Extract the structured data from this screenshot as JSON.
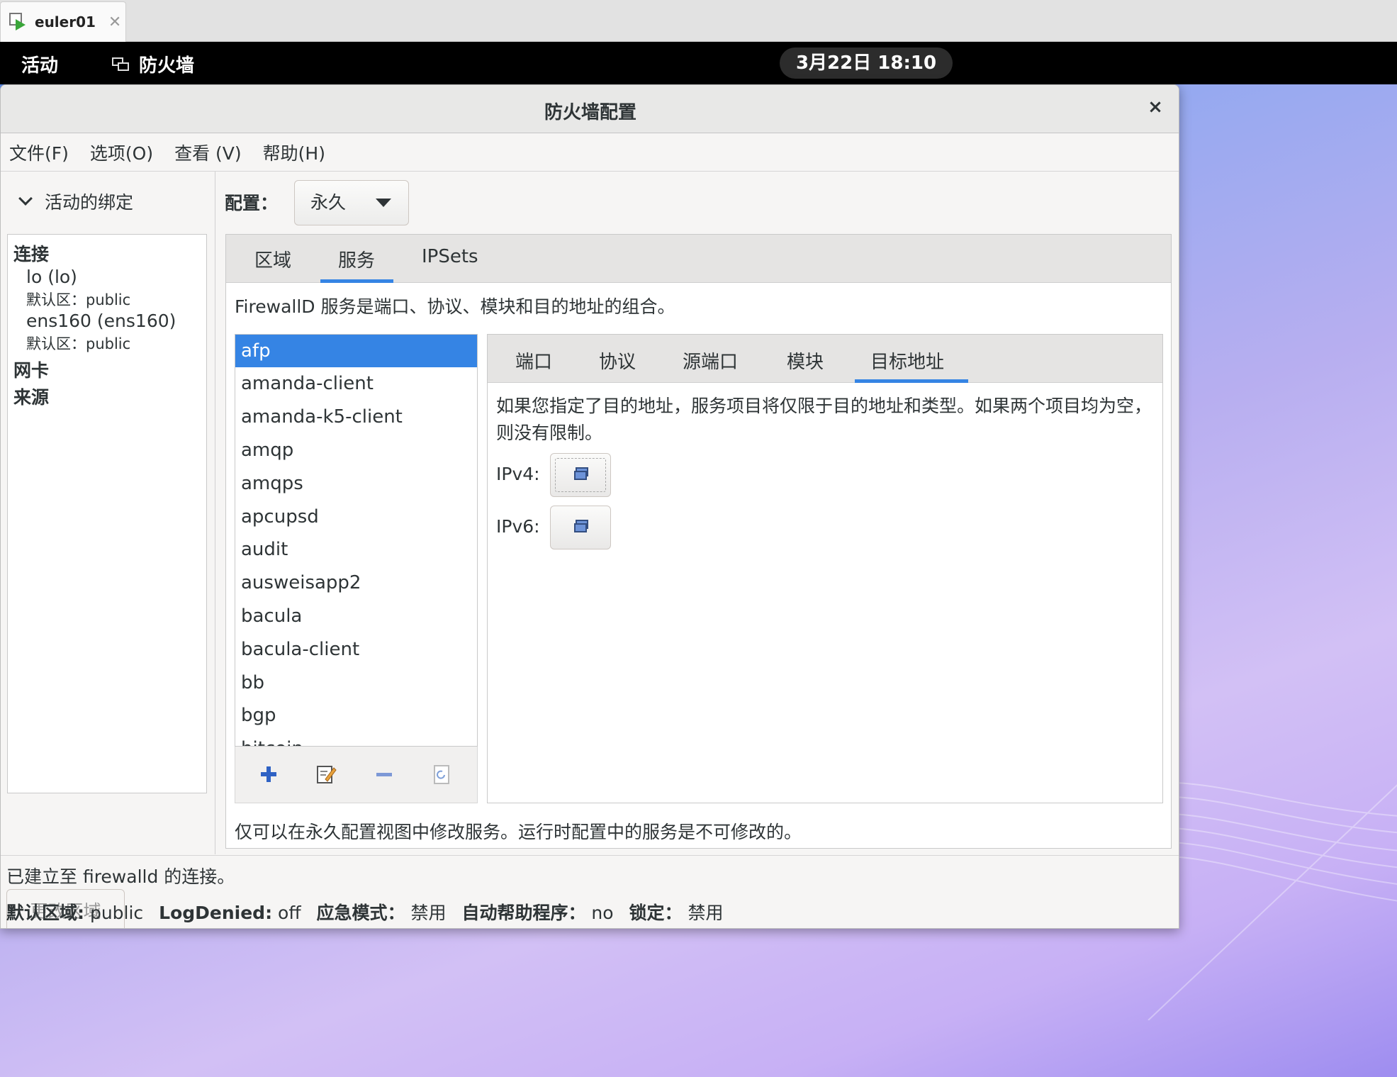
{
  "vm": {
    "tab_title": "euler01",
    "close_glyph": "✕"
  },
  "topbar": {
    "activities": "活动",
    "app_name": "防火墙",
    "clock": "3月22日 18:10"
  },
  "window": {
    "title": "防火墙配置",
    "close_glyph": "×"
  },
  "menu": [
    "文件(F)",
    "选项(O)",
    "查看 (V)",
    "帮助(H)"
  ],
  "left": {
    "header": "活动的绑定",
    "groups": {
      "connections": "连接",
      "nics": "网卡",
      "sources": "来源"
    },
    "connections": [
      {
        "name": "lo (lo)",
        "zone": "默认区：public"
      },
      {
        "name": "ens160 (ens160)",
        "zone": "默认区：public"
      }
    ],
    "change_zone_button": "更改区域"
  },
  "config": {
    "label": "配置：",
    "value": "永久"
  },
  "tabs": [
    "区域",
    "服务",
    "IPSets"
  ],
  "services": {
    "description": "FirewallD 服务是端口、协议、模块和目的地址的组合。",
    "items": [
      "afp",
      "amanda-client",
      "amanda-k5-client",
      "amqp",
      "amqps",
      "apcupsd",
      "audit",
      "ausweisapp2",
      "bacula",
      "bacula-client",
      "bb",
      "bgp",
      "bitcoin"
    ],
    "selected": "afp",
    "note": "仅可以在永久配置视图中修改服务。运行时配置中的服务是不可修改的。"
  },
  "detail": {
    "tabs": [
      "端口",
      "协议",
      "源端口",
      "模块",
      "目标地址"
    ],
    "active_tab": "目标地址",
    "text": "如果您指定了目的地址，服务项目将仅限于目的地址和类型。如果两个项目均为空，则没有限制。",
    "ipv4_label": "IPv4:",
    "ipv6_label": "IPv6:"
  },
  "status": {
    "line1": "已建立至 firewalld 的连接。",
    "default_zone_label": "默认区域:",
    "default_zone": "public",
    "logdenied_label": "LogDenied:",
    "logdenied": "off",
    "panic_label": "应急模式：",
    "panic": "禁用",
    "helper_label": "自动帮助程序：",
    "helper": "no",
    "lock_label": "锁定：",
    "lock": "禁用"
  },
  "colors": {
    "accent": "#3584e4",
    "topbar": "#000000"
  },
  "icons": [
    "vm-play-icon",
    "firewall-app-icon",
    "chevron-down-icon",
    "add-icon",
    "edit-icon",
    "remove-icon",
    "reload-icon",
    "network-icon"
  ]
}
